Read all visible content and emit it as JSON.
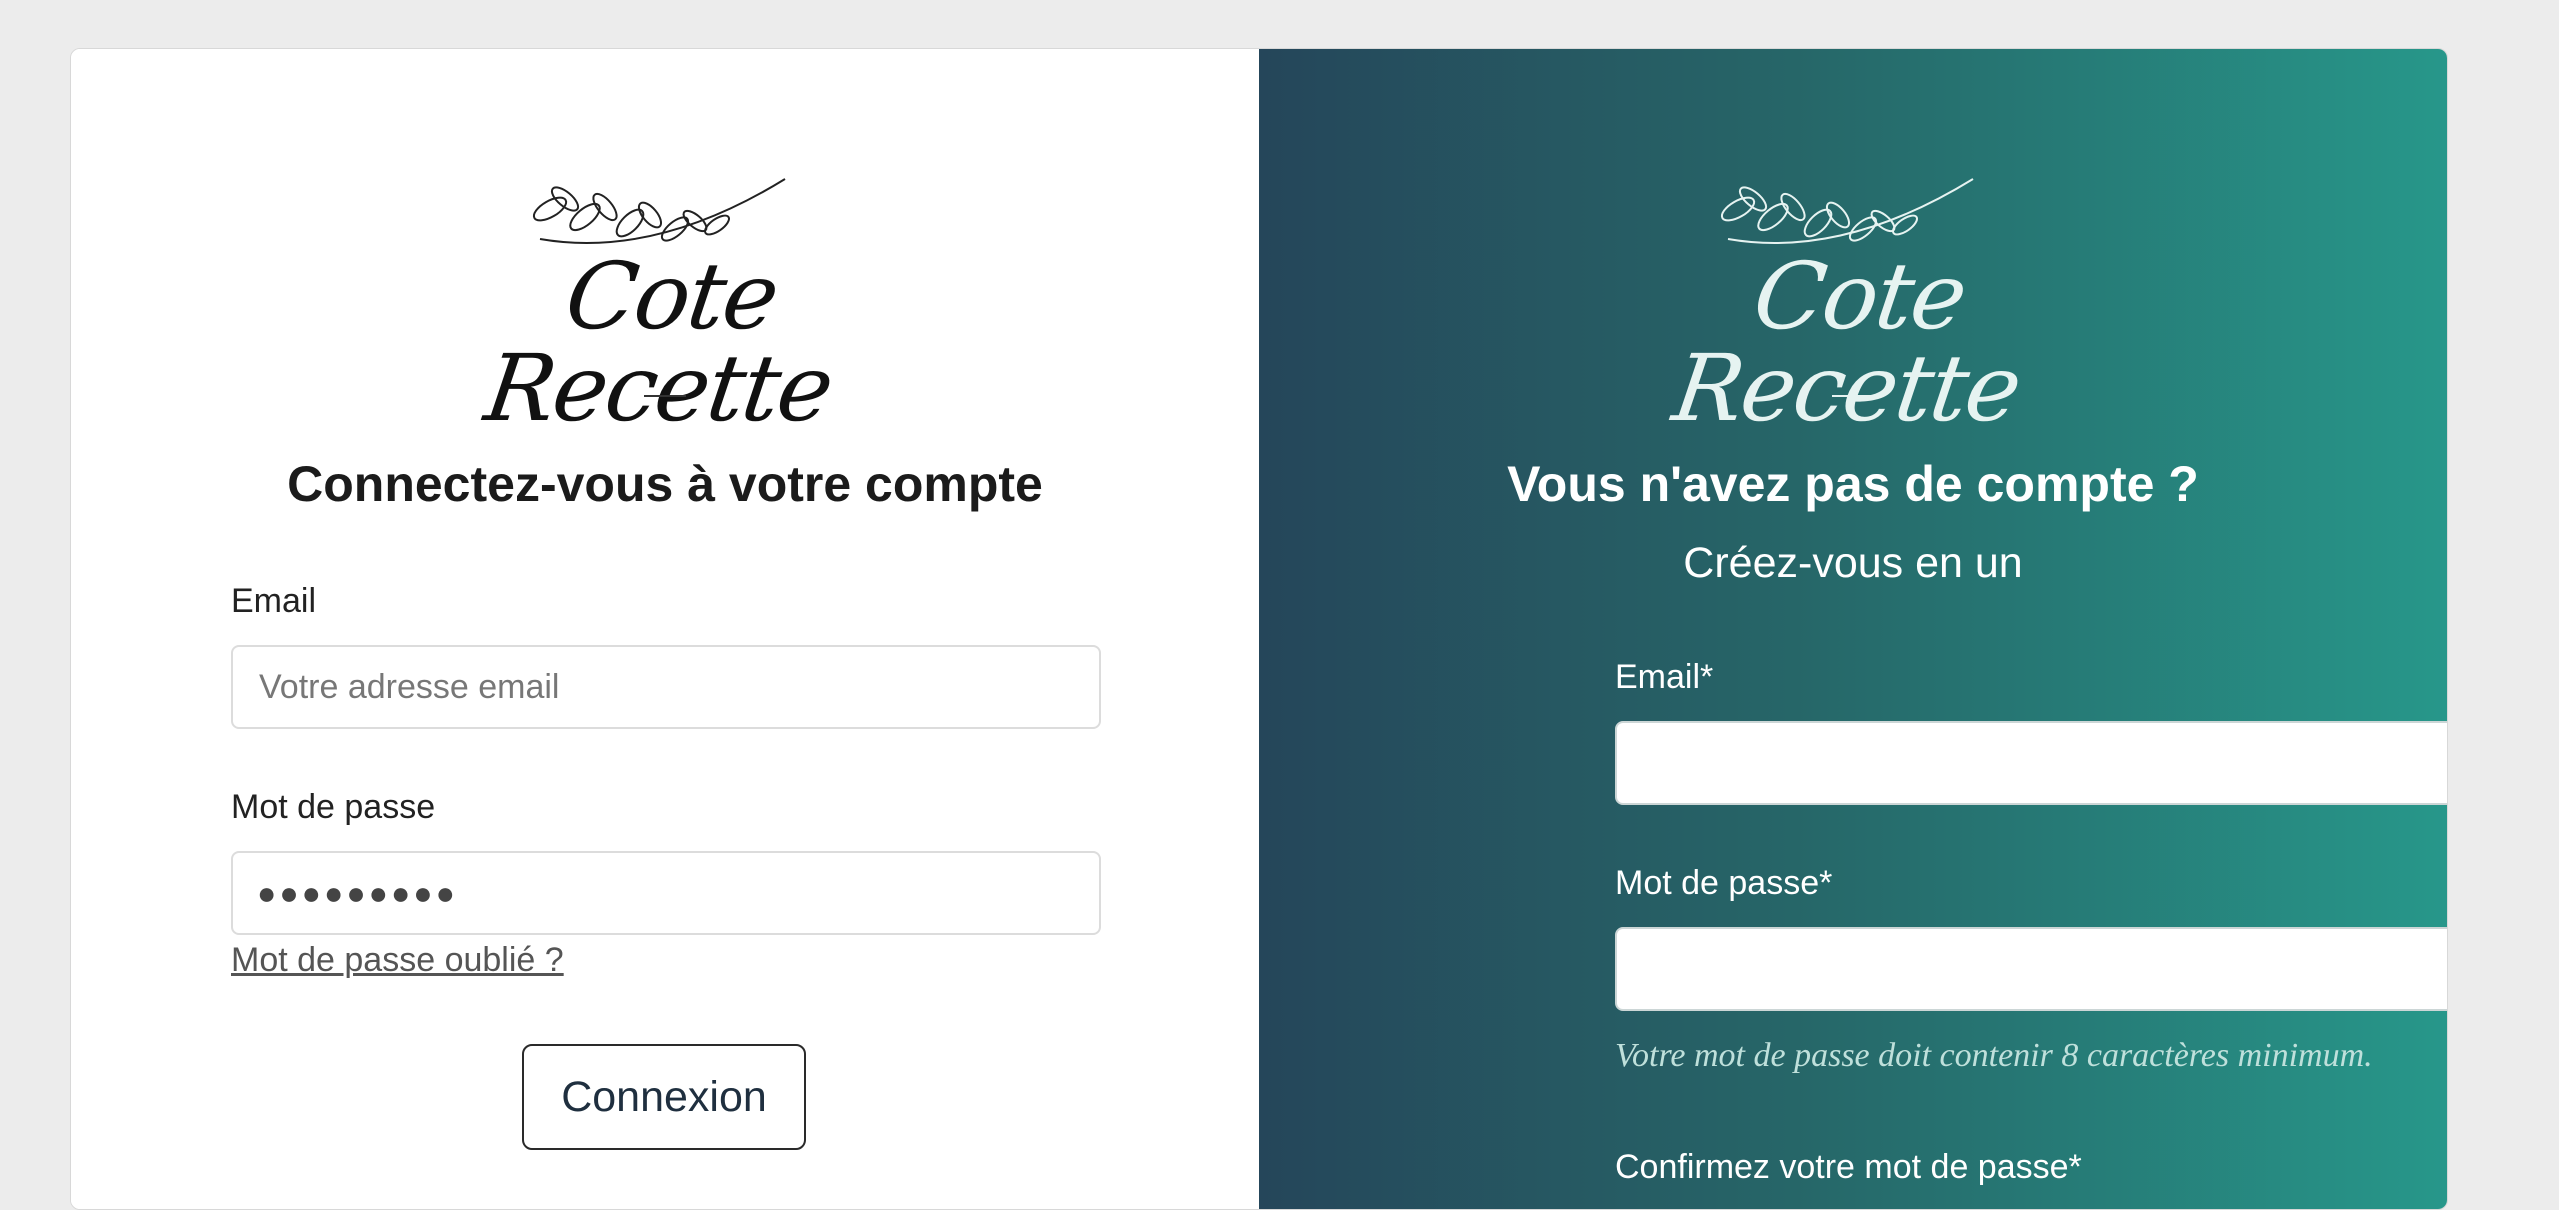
{
  "brand": {
    "name": "Cote Recette"
  },
  "login": {
    "heading": "Connectez-vous à votre compte",
    "email_label": "Email",
    "email_placeholder": "Votre adresse email",
    "password_label": "Mot de passe",
    "password_value": "●●●●●●●●●",
    "forgot_link": "Mot de passe oublié ?",
    "submit_label": "Connexion"
  },
  "signup": {
    "heading": "Vous n'avez pas de compte ?",
    "subheading": "Créez-vous en un",
    "email_label": "Email*",
    "password_label": "Mot de passe*",
    "password_hint": "Votre mot de passe doit contenir 8 caractères minimum.",
    "confirm_label": "Confirmez votre mot de passe*"
  },
  "colors": {
    "page_bg": "#ececec",
    "gradient_start": "#25465a",
    "gradient_end": "#27978a",
    "card_bg": "#ffffff"
  }
}
